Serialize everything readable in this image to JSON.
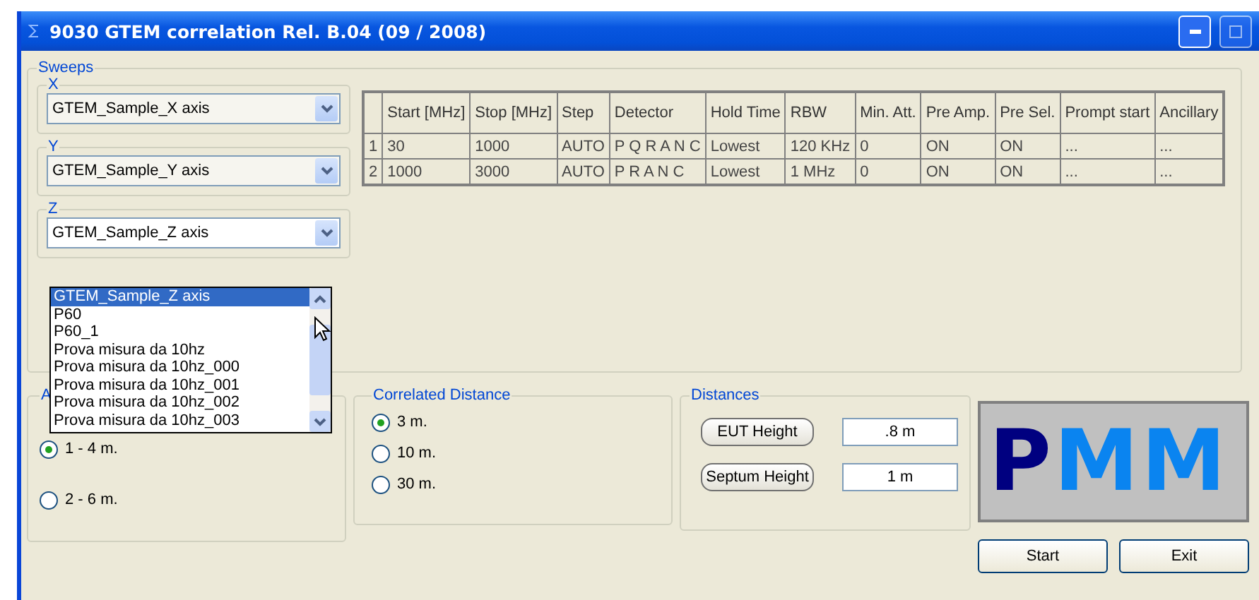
{
  "window": {
    "title": "9030 GTEM correlation Rel. B.04 (09 / 2008)"
  },
  "sweeps": {
    "label": "Sweeps",
    "axes": [
      {
        "label": "X",
        "value": "GTEM_Sample_X axis",
        "open": false
      },
      {
        "label": "Y",
        "value": "GTEM_Sample_Y axis",
        "open": false
      },
      {
        "label": "Z",
        "value": "GTEM_Sample_Z axis",
        "open": true
      }
    ]
  },
  "dropdown_list": {
    "items": [
      {
        "label": "GTEM_Sample_Z axis",
        "selected": true
      },
      {
        "label": "P60",
        "selected": false
      },
      {
        "label": "P60_1",
        "selected": false
      },
      {
        "label": "Prova misura da 10hz",
        "selected": false
      },
      {
        "label": "Prova misura da 10hz_000",
        "selected": false
      },
      {
        "label": "Prova misura da 10hz_001",
        "selected": false
      },
      {
        "label": "Prova misura da 10hz_002",
        "selected": false
      },
      {
        "label": "Prova misura da 10hz_003",
        "selected": false
      }
    ]
  },
  "table": {
    "columns": [
      "",
      "Start [MHz]",
      "Stop [MHz]",
      "Step",
      "Detector",
      "Hold Time",
      "RBW",
      "Min. Att.",
      "Pre Amp.",
      "Pre Sel.",
      "Prompt start",
      "Ancillary"
    ],
    "rows": [
      [
        "1",
        "30",
        "1000",
        "AUTO",
        "P Q R A N C",
        "Lowest",
        "120 KHz",
        "0",
        "ON",
        "ON",
        "...",
        "..."
      ],
      [
        "2",
        "1000",
        "3000",
        "AUTO",
        "P R A N C",
        "Lowest",
        "1 MHz",
        "0",
        "ON",
        "ON",
        "...",
        "..."
      ]
    ]
  },
  "antenna_distance": {
    "label": "A",
    "options": [
      {
        "label": "1 - 4 m.",
        "selected": true
      },
      {
        "label": "2 - 6 m.",
        "selected": false
      }
    ]
  },
  "correlated_distance": {
    "label": "Correlated Distance",
    "options": [
      {
        "label": "3 m.",
        "selected": true
      },
      {
        "label": "10 m.",
        "selected": false
      },
      {
        "label": "30 m.",
        "selected": false
      }
    ]
  },
  "distances": {
    "label": "Distances",
    "fields": [
      {
        "button": "EUT Height",
        "value": ".8 m"
      },
      {
        "button": "Septum Height",
        "value": "1 m"
      }
    ]
  },
  "logo": {
    "letters": [
      {
        "char": "P",
        "color": "#000080"
      },
      {
        "char": "M",
        "color": "#0a84f0"
      },
      {
        "char": "M",
        "color": "#0a84f0"
      }
    ]
  },
  "buttons": [
    "Start",
    "Exit"
  ]
}
